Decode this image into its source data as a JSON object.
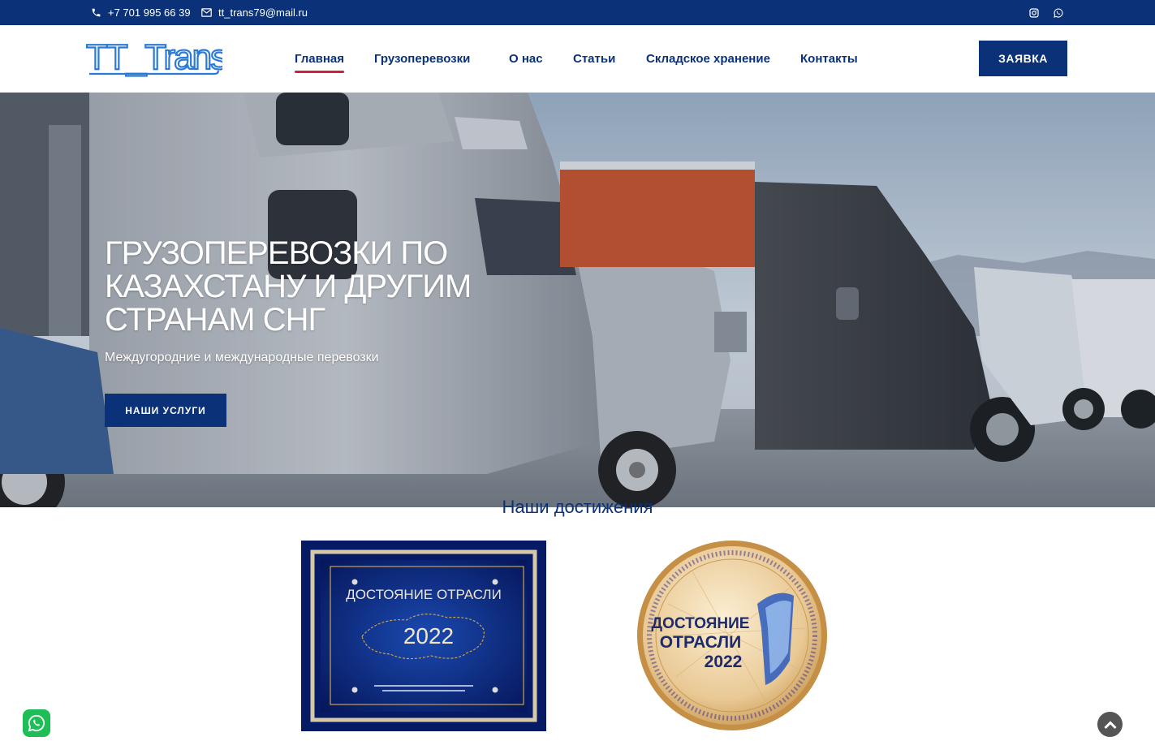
{
  "topbar": {
    "phone": "+7 701 995 66 39",
    "email": "tt_trans79@mail.ru",
    "icons": [
      "phone-icon",
      "envelope-icon",
      "instagram-icon",
      "whatsapp-icon"
    ]
  },
  "header": {
    "logo_text": "TT_Trans",
    "nav": [
      "Главная",
      "Грузоперевозки",
      "О нас",
      "Статьи",
      "Складское хранение",
      "Контакты"
    ],
    "active_nav": "Главная",
    "cta_label": "ЗАЯВКА"
  },
  "hero": {
    "title": "ГРУЗОПЕРЕВОЗКИ ПО КАЗАХСТАНУ И ДРУГИМ СТРАНАМ СНГ",
    "subtitle": "Междугородние и международные перевозки",
    "button_label": "НАШИ УСЛУГИ"
  },
  "achievements": {
    "title": "Наши достижения",
    "award1": {
      "heading": "ДОСТОЯНИЕ ОТРАСЛИ",
      "year": "2022"
    },
    "award2": {
      "line1": "ДОСТОЯНИЕ",
      "line2": "ОТРАСЛИ",
      "year": "2022"
    }
  },
  "colors": {
    "primary": "#0b3178",
    "accent": "#d01f3c",
    "whatsapp": "#1ebe57"
  }
}
